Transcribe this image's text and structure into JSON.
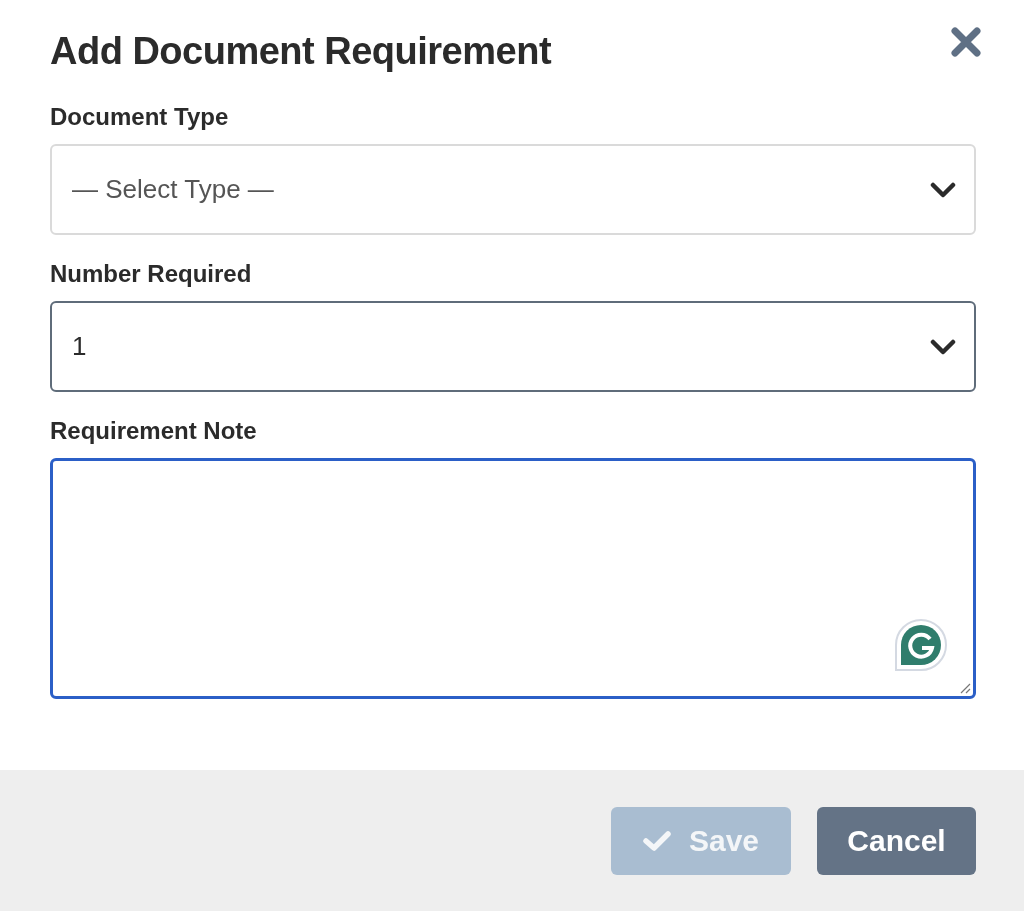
{
  "dialog": {
    "title": "Add Document Requirement"
  },
  "fields": [
    {
      "kind": "select",
      "label": "Document Type",
      "placeholder": "— Select Type —",
      "focused": false
    },
    {
      "kind": "select",
      "label": "Number Required",
      "value": "1",
      "focused": false
    },
    {
      "kind": "textarea",
      "label": "Requirement Note",
      "focused": true
    }
  ],
  "buttons": [
    {
      "kind": "save",
      "label": "Save",
      "disabled": true
    },
    {
      "kind": "cancel",
      "label": "Cancel",
      "disabled": false
    }
  ]
}
